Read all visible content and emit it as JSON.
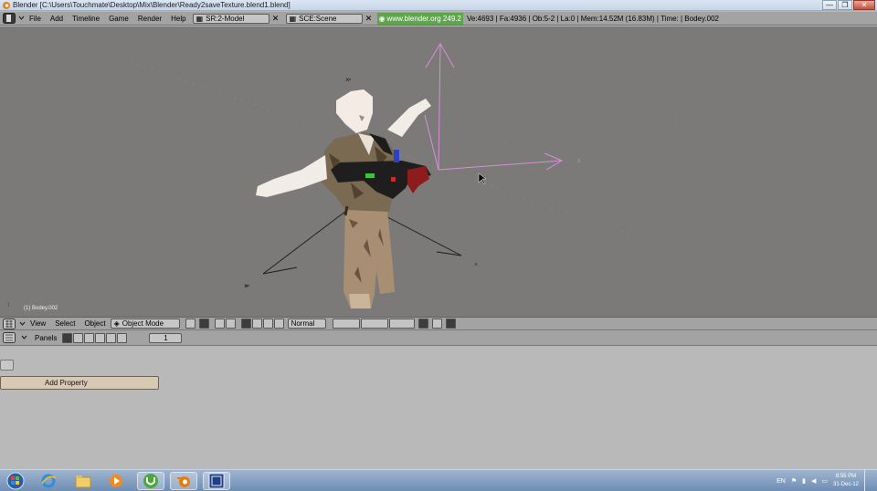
{
  "window": {
    "title": "Blender [C:\\Users\\Touchmate\\Desktop\\Mix\\Blender\\Ready2saveTexture.blend1.blend]",
    "minimize": "—",
    "maximize": "❐",
    "close": "✕"
  },
  "info_header": {
    "menus": [
      "File",
      "Add",
      "Timeline",
      "Game",
      "Render",
      "Help"
    ],
    "screen_field": "SR:2-Model",
    "scene_field": "SCE:Scene",
    "website": "www.blender.org 249.2",
    "stats": "Ve:4693 | Fa:4936 | Ob:5-2 | La:0 | Mem:14.52M (16.83M) | Time: | Bodey.002"
  },
  "viewport": {
    "object_label": "(1) Bodey.002"
  },
  "view3d_header": {
    "menus": [
      "View",
      "Select",
      "Object"
    ],
    "mode": "Object Mode",
    "pivot": "Normal"
  },
  "buttons_header": {
    "panels_label": "Panels",
    "frame": "1"
  },
  "logic": {
    "add_property": "Add Property"
  },
  "taskbar": {
    "icons": [
      "start-orb-icon",
      "internet-explorer-icon",
      "file-explorer-icon",
      "media-player-icon",
      "utorrent-icon",
      "blender-icon",
      "blender-window-icon"
    ],
    "lang": "EN",
    "time": "8:55 PM",
    "date": "31-Dec-12"
  },
  "colors": {
    "viewport_bg": "#7b7a78",
    "header_bg": "#a3a3a3",
    "website_bg": "#5fa54c",
    "add_property_bg": "#d8c9b5",
    "taskbar": "#6e8db3"
  }
}
